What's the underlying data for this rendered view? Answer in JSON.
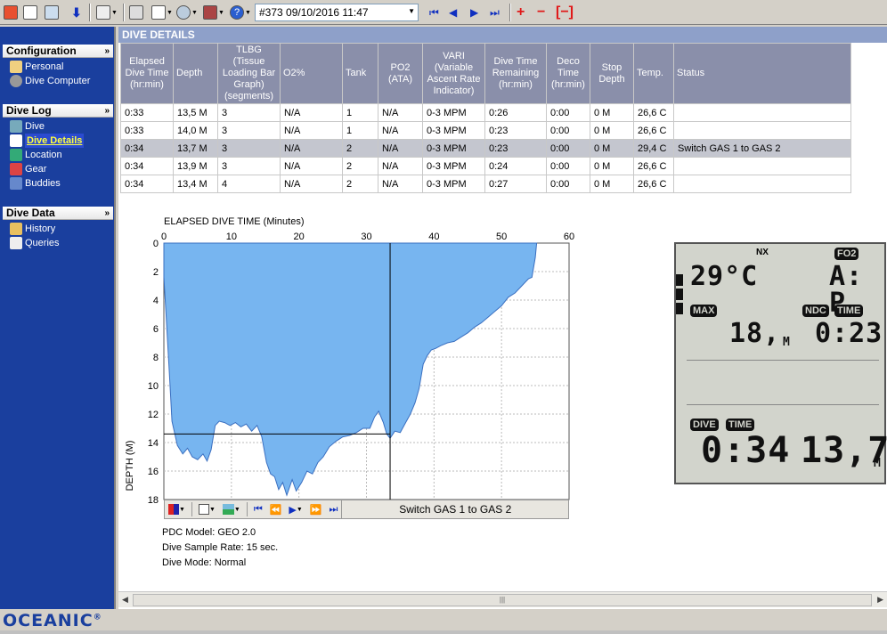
{
  "toolbar": {
    "dive_selector": "#373 09/10/2016 11:47"
  },
  "sidebar": {
    "groups": [
      {
        "title": "Configuration",
        "items": [
          {
            "label": "Personal",
            "icon": "person-icon"
          },
          {
            "label": "Dive Computer",
            "icon": "dive-computer-icon"
          }
        ]
      },
      {
        "title": "Dive Log",
        "items": [
          {
            "label": "Dive",
            "icon": "dive-icon"
          },
          {
            "label": "Dive Details",
            "icon": "dive-details-icon",
            "active": true
          },
          {
            "label": "Location",
            "icon": "location-icon"
          },
          {
            "label": "Gear",
            "icon": "gear-icon"
          },
          {
            "label": "Buddies",
            "icon": "buddies-icon"
          }
        ]
      },
      {
        "title": "Dive Data",
        "items": [
          {
            "label": "History",
            "icon": "history-icon"
          },
          {
            "label": "Queries",
            "icon": "queries-icon"
          }
        ]
      }
    ]
  },
  "logo": "OCEANIC",
  "main": {
    "title": "DIVE DETAILS",
    "table": {
      "headers": [
        "Elapsed Dive Time (hr:min)",
        "Depth",
        "TLBG (Tissue Loading Bar Graph) (segments)",
        "O2%",
        "Tank",
        "PO2 (ATA)",
        "VARI (Variable Ascent Rate Indicator)",
        "Dive Time Remaining (hr:min)",
        "Deco Time (hr:min)",
        "Stop Depth",
        "Temp.",
        "Status"
      ],
      "rows": [
        [
          "0:33",
          "13,5 M",
          "3",
          "N/A",
          "1",
          "N/A",
          "0-3 MPM",
          "0:26",
          "0:00",
          "0 M",
          "26,6 C",
          ""
        ],
        [
          "0:33",
          "14,0 M",
          "3",
          "N/A",
          "1",
          "N/A",
          "0-3 MPM",
          "0:23",
          "0:00",
          "0 M",
          "26,6 C",
          ""
        ],
        [
          "0:34",
          "13,7 M",
          "3",
          "N/A",
          "2",
          "N/A",
          "0-3 MPM",
          "0:23",
          "0:00",
          "0 M",
          "29,4 C",
          "Switch GAS 1 to GAS 2"
        ],
        [
          "0:34",
          "13,9 M",
          "3",
          "N/A",
          "2",
          "N/A",
          "0-3 MPM",
          "0:24",
          "0:00",
          "0 M",
          "26,6 C",
          ""
        ],
        [
          "0:34",
          "13,4 M",
          "4",
          "N/A",
          "2",
          "N/A",
          "0-3 MPM",
          "0:27",
          "0:00",
          "0 M",
          "26,6 C",
          ""
        ]
      ],
      "selected_row": 2
    }
  },
  "chart_data": {
    "type": "area",
    "title": "ELAPSED DIVE TIME (Minutes)",
    "xlabel": "ELAPSED DIVE TIME (Minutes)",
    "ylabel": "DEPTH (M)",
    "xlim": [
      0,
      60
    ],
    "ylim": [
      0,
      18
    ],
    "y_inverted": true,
    "x_ticks": [
      0,
      10,
      20,
      30,
      40,
      50,
      60
    ],
    "y_ticks": [
      0,
      2,
      4,
      6,
      8,
      10,
      12,
      14,
      16,
      18
    ],
    "grid": true,
    "cursor": {
      "x": 33.5,
      "y": 13.4
    },
    "series": [
      {
        "x": [
          0,
          0.3,
          0.8,
          1.2,
          2,
          2.8,
          3.5,
          4.2,
          5,
          5.8,
          6.4,
          7,
          7.6,
          8.2,
          9,
          9.8,
          10.6,
          11.4,
          12.2,
          13,
          13.8,
          14.5,
          15.2,
          15.8,
          16.4,
          17,
          17.6,
          18.2,
          19,
          19.6,
          20.4,
          21.2,
          22,
          22.8,
          23.6,
          24.5,
          25.5,
          26.5,
          27.5,
          28.5,
          29.5,
          30.5,
          31.2,
          31.8,
          32.5,
          33,
          33.5,
          34.2,
          35,
          35.8,
          36.5,
          37.2,
          37.8,
          38.4,
          39,
          39.6,
          40.2,
          41,
          42,
          43,
          44,
          45,
          46,
          47,
          48,
          49,
          50,
          51,
          52,
          53,
          54,
          54.5,
          55,
          55.2
        ],
        "values": [
          2.4,
          4.8,
          9,
          12.5,
          14.2,
          14.8,
          14.4,
          15.0,
          15.2,
          14.8,
          15.3,
          14.5,
          12.8,
          12.5,
          12.6,
          12.8,
          12.6,
          12.9,
          12.7,
          13.2,
          12.8,
          13.6,
          15.4,
          16.2,
          16.4,
          17.3,
          16.8,
          17.7,
          16.6,
          17.4,
          16.8,
          16.0,
          16.2,
          15.4,
          15.0,
          14.3,
          13.9,
          13.6,
          13.5,
          13.3,
          13.0,
          13.0,
          12.2,
          11.8,
          12.6,
          13.4,
          13.7,
          13.2,
          13.3,
          12.6,
          12.0,
          11.2,
          10.2,
          8.5,
          7.9,
          7.5,
          7.4,
          7.2,
          7.0,
          6.9,
          6.6,
          6.3,
          5.9,
          5.6,
          5.2,
          4.8,
          4.4,
          3.8,
          3.5,
          3.0,
          2.5,
          2.4,
          1.0,
          0
        ]
      }
    ]
  },
  "chart_toolbar": {
    "status_text": "Switch GAS 1 to GAS 2"
  },
  "dive_info": {
    "pdc_model": "PDC Model: GEO 2.0",
    "sample_rate": "Dive Sample Rate: 15 sec.",
    "dive_mode": "Dive Mode: Normal"
  },
  "lcd": {
    "nx_label": "NX",
    "fo2_label": "FO2",
    "temperature": "29°C",
    "fo2_value": "A: P",
    "max_label": "MAX",
    "max_depth": "18,",
    "max_unit": "M",
    "ndc_label": "NDC",
    "time_label": "TIME",
    "ndc_time": "0:23",
    "dive_label": "DIVE",
    "dive_time_label": "TIME",
    "dive_time": "0:34",
    "depth": "13,7",
    "depth_unit": "M"
  },
  "colors": {
    "sidebar_bg": "#1a3f9e",
    "area_fill": "#77b5f0",
    "header_bg": "#8a8faa",
    "selected_row": "#c4c6cf",
    "toolbar_red": "#e01818"
  }
}
